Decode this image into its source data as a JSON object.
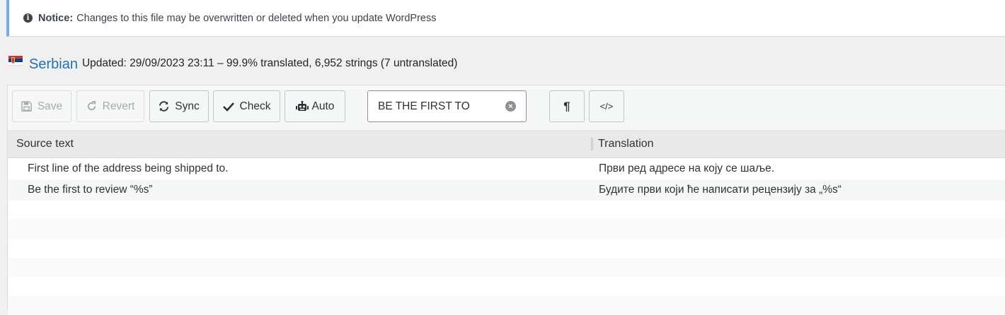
{
  "notice": {
    "label": "Notice:",
    "text": "Changes to this file may be overwritten or deleted when you update WordPress",
    "icon": "info-icon"
  },
  "language": {
    "name": "Serbian",
    "meta": "Updated: 29/09/2023 23:11 – 99.9% translated, 6,952 strings (7 untranslated)",
    "flag": "serbia-flag"
  },
  "toolbar": {
    "save_label": "Save",
    "revert_label": "Revert",
    "sync_label": "Sync",
    "check_label": "Check",
    "auto_label": "Auto",
    "search_value": "BE THE FIRST TO",
    "pilcrow_label": "¶",
    "code_label": "</>"
  },
  "table": {
    "headers": {
      "source": "Source text",
      "translation": "Translation"
    },
    "rows": [
      {
        "source": "First line of the address being shipped to.",
        "translation": "Први ред адресе на коју се шаље."
      },
      {
        "source": "Be the first to review “%s”",
        "translation": "Будите први који ће написати рецензију за „%s“"
      }
    ]
  },
  "colors": {
    "accent": "#2271b1",
    "notice_border": "#72aee6"
  }
}
